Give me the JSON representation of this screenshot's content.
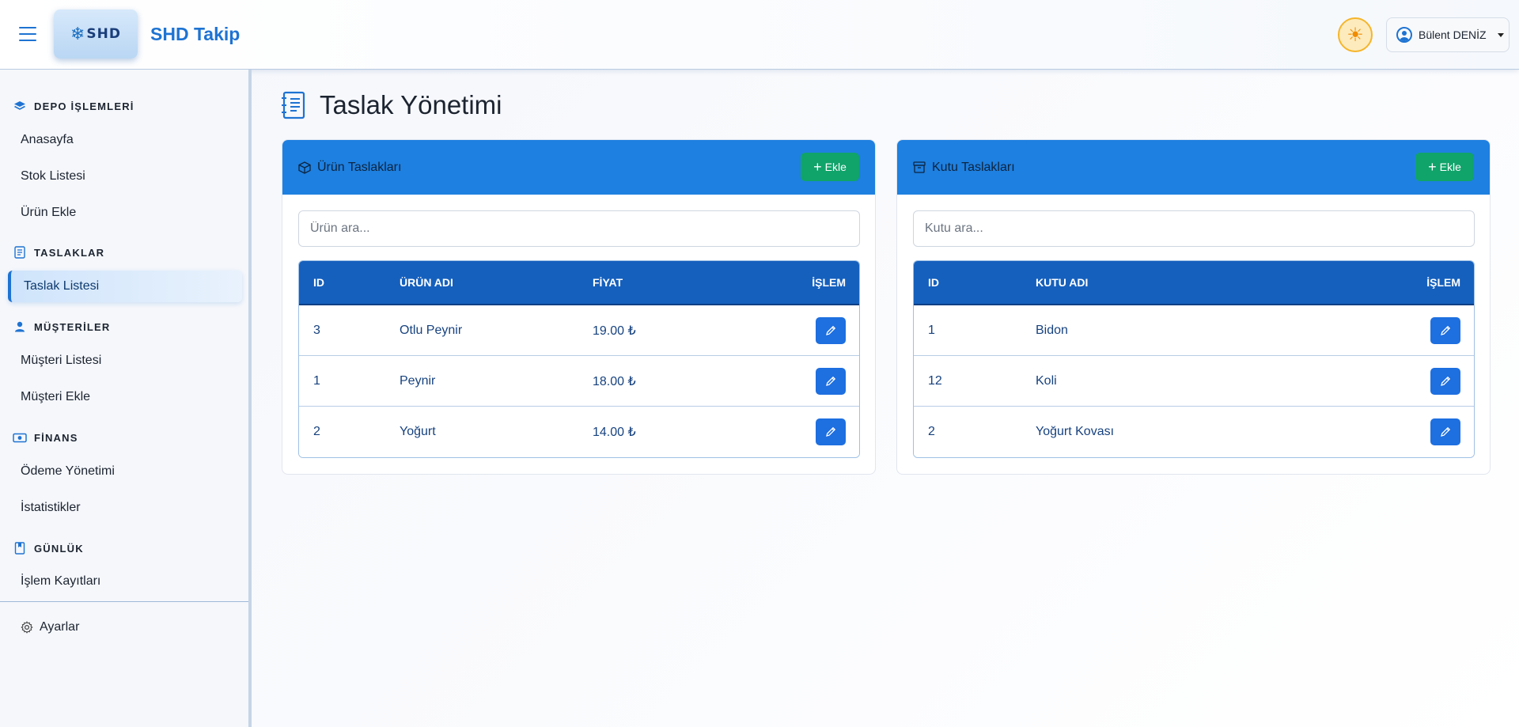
{
  "header": {
    "logo_text": "SHD",
    "app_title": "SHD Takip",
    "user_name": "Bülent DENİZ"
  },
  "sidebar": {
    "sections": [
      {
        "label": "DEPO İŞLEMLERİ",
        "icon": "layers-icon",
        "items": [
          "Anasayfa",
          "Stok Listesi",
          "Ürün Ekle"
        ]
      },
      {
        "label": "TASLAKLAR",
        "icon": "list-icon",
        "items": [
          "Taslak Listesi"
        ]
      },
      {
        "label": "MÜŞTERİLER",
        "icon": "person-icon",
        "items": [
          "Müşteri Listesi",
          "Müşteri Ekle"
        ]
      },
      {
        "label": "FİNANS",
        "icon": "cash-icon",
        "items": [
          "Ödeme Yönetimi",
          "İstatistikler"
        ]
      },
      {
        "label": "GÜNLÜK",
        "icon": "journal-icon",
        "items": [
          "İşlem Kayıtları"
        ]
      }
    ],
    "active_item": "Taslak Listesi",
    "settings_label": "Ayarlar"
  },
  "main": {
    "page_title": "Taslak Yönetimi",
    "product_card": {
      "title": "Ürün Taslakları",
      "add_label": "Ekle",
      "search_placeholder": "Ürün ara...",
      "columns": [
        "ID",
        "ÜRÜN ADI",
        "FİYAT",
        "İŞLEM"
      ],
      "rows": [
        {
          "id": "3",
          "name": "Otlu Peynir",
          "price": "19.00 ₺"
        },
        {
          "id": "1",
          "name": "Peynir",
          "price": "18.00 ₺"
        },
        {
          "id": "2",
          "name": "Yoğurt",
          "price": "14.00 ₺"
        }
      ]
    },
    "box_card": {
      "title": "Kutu Taslakları",
      "add_label": "Ekle",
      "search_placeholder": "Kutu ara...",
      "columns": [
        "ID",
        "KUTU ADI",
        "İŞLEM"
      ],
      "rows": [
        {
          "id": "1",
          "name": "Bidon"
        },
        {
          "id": "12",
          "name": "Koli"
        },
        {
          "id": "2",
          "name": "Yoğurt Kovası"
        }
      ]
    }
  },
  "colors": {
    "primary": "#1e73d2",
    "card_header": "#1e80e0",
    "table_header": "#1560bd",
    "add_button": "#10a36a",
    "edit_button": "#1e6fe0"
  }
}
